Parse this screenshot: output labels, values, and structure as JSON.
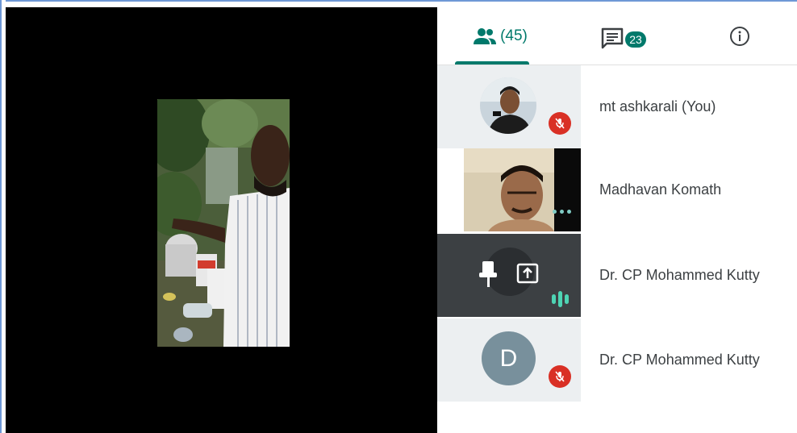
{
  "tabs": {
    "people": {
      "icon": "people-icon",
      "count": "(45)"
    },
    "chat": {
      "icon": "chat-icon",
      "badge": "23"
    },
    "info": {
      "icon": "info-icon"
    }
  },
  "participants": [
    {
      "name": "mt ashkarali (You)",
      "tile": "photo-avatar",
      "muted": true
    },
    {
      "name": "Madhavan Komath",
      "tile": "video",
      "muted": false
    },
    {
      "name": "Dr. CP Mohammed Kutty",
      "tile": "hover-controls",
      "muted": false,
      "speaking": true
    },
    {
      "name": "Dr. CP Mohammed Kutty",
      "tile": "letter-avatar",
      "avatar_letter": "D",
      "muted": true
    }
  ],
  "colors": {
    "accent": "#00796b",
    "mic_off": "#d93025",
    "avatar_bg": "#78909c",
    "speaking": "#4ed4b4"
  }
}
